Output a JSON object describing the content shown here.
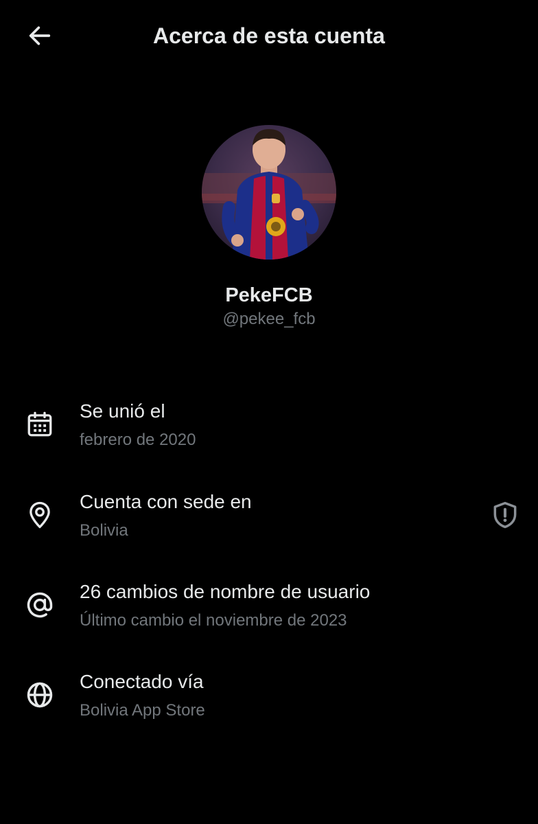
{
  "header": {
    "title": "Acerca de esta cuenta",
    "back_icon": "arrow-left-icon"
  },
  "profile": {
    "display_name": "PekeFCB",
    "handle": "@pekee_fcb",
    "avatar": "profile-photo"
  },
  "info": [
    {
      "icon": "calendar-icon",
      "title": "Se unió el",
      "subtitle": "febrero de 2020"
    },
    {
      "icon": "location-pin-icon",
      "title": "Cuenta con sede en",
      "subtitle": "Bolivia",
      "trailing_icon": "shield-alert-icon"
    },
    {
      "icon": "at-sign-icon",
      "title": "26 cambios de nombre de usuario",
      "subtitle": "Último cambio el noviembre de 2023"
    },
    {
      "icon": "globe-icon",
      "title": "Conectado vía",
      "subtitle": "Bolivia App Store"
    }
  ],
  "colors": {
    "background": "#000000",
    "primary_text": "#e7e9ea",
    "secondary_text": "#71767b"
  }
}
